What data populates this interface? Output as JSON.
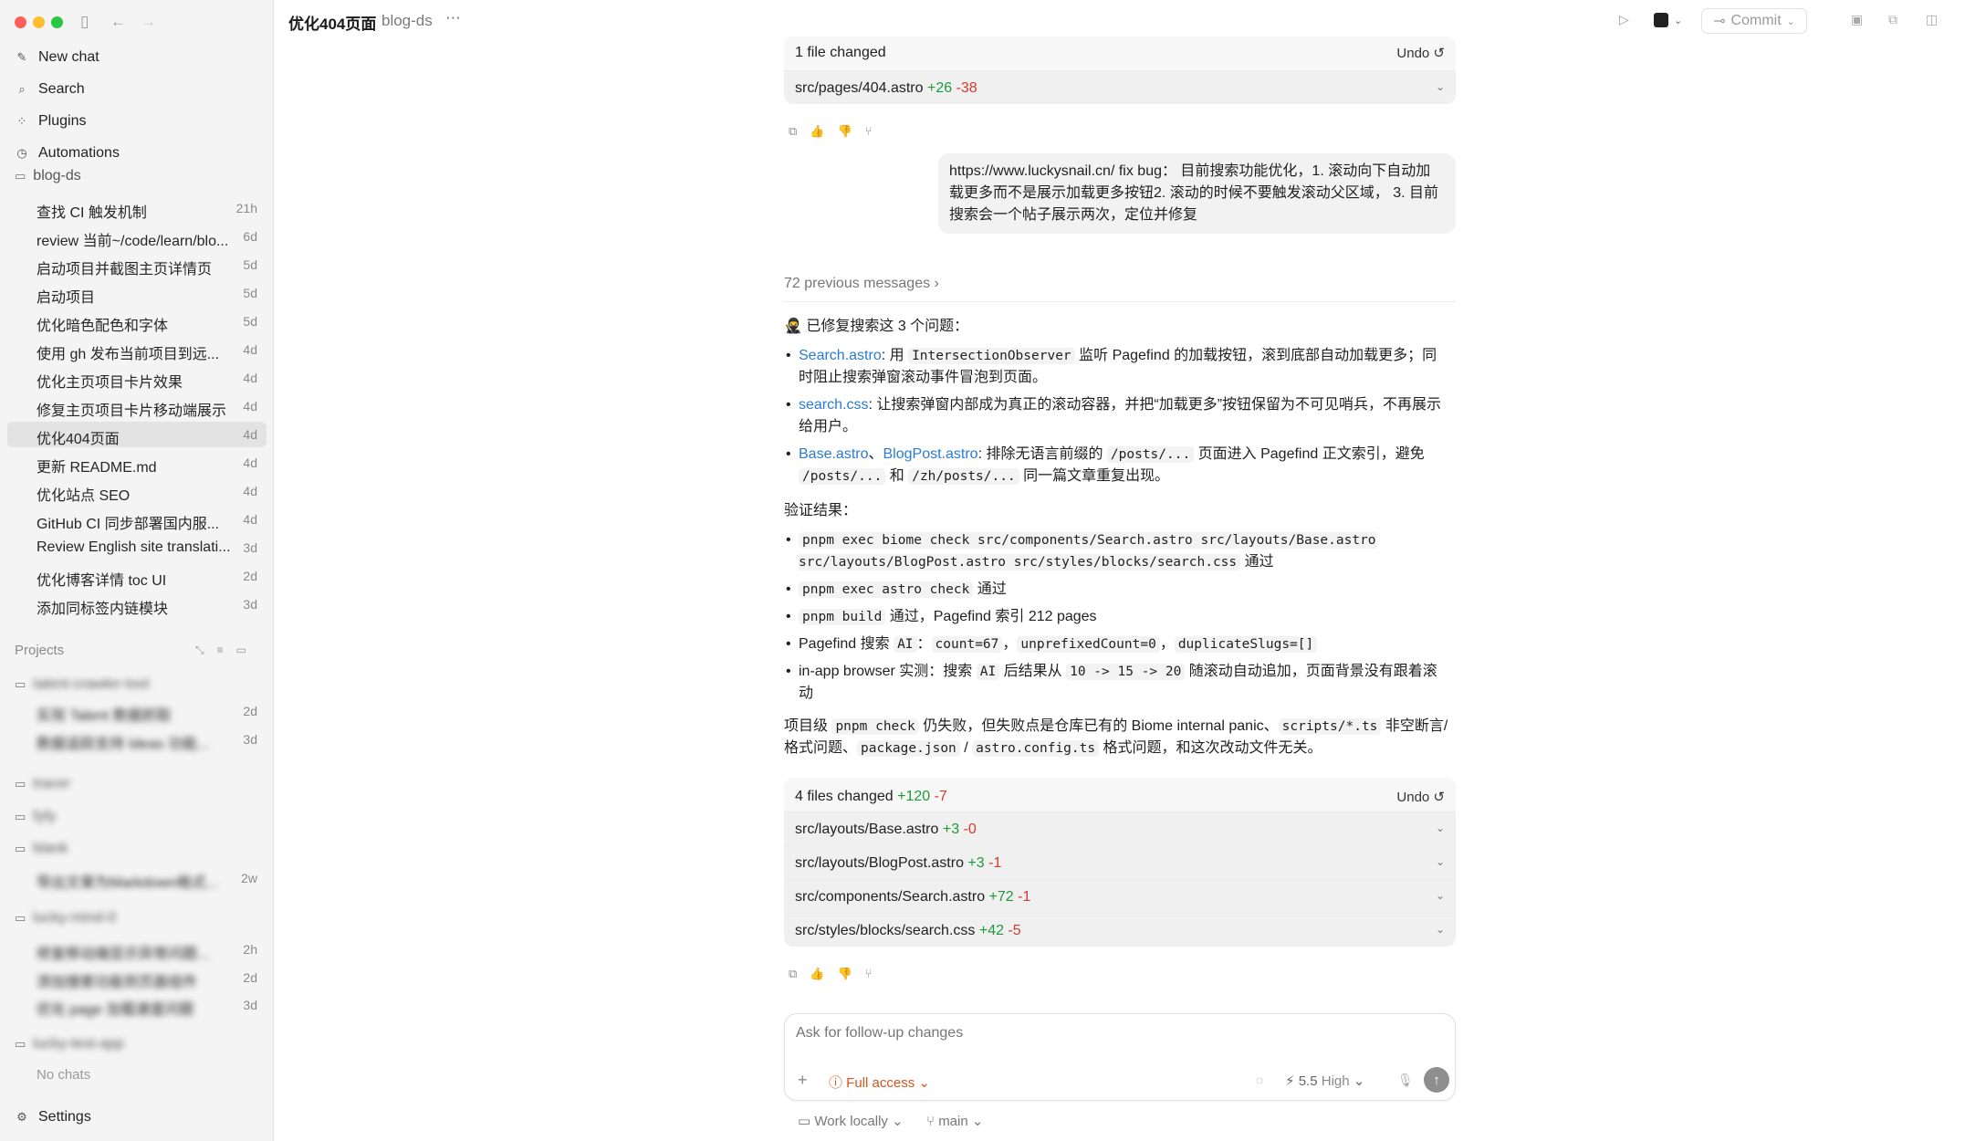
{
  "window": {
    "title": "优化404页面",
    "project": "blog-ds"
  },
  "sidebar": {
    "nav": [
      {
        "label": "New chat",
        "icon": "new-chat-icon"
      },
      {
        "label": "Search",
        "icon": "search-icon"
      },
      {
        "label": "Plugins",
        "icon": "plugins-icon"
      },
      {
        "label": "Automations",
        "icon": "clock-icon"
      }
    ],
    "workspace": "blog-ds",
    "chats": [
      {
        "title": "查找 CI 触发机制",
        "age": "21h"
      },
      {
        "title": "review 当前~/code/learn/blo...",
        "age": "6d"
      },
      {
        "title": "启动项目并截图主页详情页",
        "age": "5d"
      },
      {
        "title": "启动项目",
        "age": "5d"
      },
      {
        "title": "优化暗色配色和字体",
        "age": "5d"
      },
      {
        "title": "使用 gh 发布当前项目到远...",
        "age": "4d"
      },
      {
        "title": "优化主页项目卡片效果",
        "age": "4d"
      },
      {
        "title": "修复主页项目卡片移动端展示",
        "age": "4d"
      },
      {
        "title": "优化404页面",
        "age": "4d"
      },
      {
        "title": "更新 README.md",
        "age": "4d"
      },
      {
        "title": "优化站点 SEO",
        "age": "4d"
      },
      {
        "title": "GitHub CI 同步部署国内服...",
        "age": "4d"
      },
      {
        "title": "Review English site translati...",
        "age": "3d"
      },
      {
        "title": "优化博客详情 toc UI",
        "age": "2d"
      },
      {
        "title": "添加同标签内链模块",
        "age": "3d"
      }
    ],
    "projects_label": "Projects",
    "project_groups": [
      {
        "name": "talent-crawler-tool",
        "chats": [
          {
            "title": "实现 Talent 数据抓取",
            "age": "2d"
          },
          {
            "title": "数据追踪支持 Ideas 功能...",
            "age": "3d"
          }
        ]
      },
      {
        "name": "tracer",
        "chats": []
      },
      {
        "name": "fyfy",
        "chats": []
      },
      {
        "name": "blank",
        "chats": [
          {
            "title": "导出文章为Markdown格式...",
            "age": "2w"
          }
        ]
      },
      {
        "name": "lucky-mind-0",
        "chats": [
          {
            "title": "修复移动端显示异常问题...",
            "age": "2h"
          },
          {
            "title": "添加搜索功能到页面组件",
            "age": "2d"
          },
          {
            "title": "优化 page 加载速度问题",
            "age": "3d"
          }
        ]
      },
      {
        "name": "lucky-test-app",
        "chats": []
      }
    ],
    "no_chats": "No chats",
    "settings": "Settings"
  },
  "toolbar": {
    "commit": "Commit"
  },
  "top_card": {
    "header": "1 file changed",
    "undo": "Undo",
    "files": [
      {
        "path": "src/pages/404.astro",
        "plus": "+26",
        "minus": "-38"
      }
    ]
  },
  "user_message": "https://www.luckysnail.cn/ fix bug： 目前搜索功能优化，1. 滚动向下自动加载更多而不是展示加载更多按钮2. 滚动的时候不要触发滚动父区域， 3. 目前搜索会一个帖子展示两次，定位并修复",
  "previous_messages": "72 previous messages",
  "assistant": {
    "intro": "已修复搜索这 3 个问题：",
    "fixes": [
      {
        "file": "Search.astro",
        "pre": ": 用 ",
        "code": "IntersectionObserver",
        "post": " 监听 Pagefind 的加载按钮，滚到底部自动加载更多；同时阻止搜索弹窗滚动事件冒泡到页面。"
      },
      {
        "file": "search.css",
        "text": ": 让搜索弹窗内部成为真正的滚动容器，并把“加载更多”按钮保留为不可见哨兵，不再展示给用户。"
      },
      {
        "file": "Base.astro",
        "sep": "、",
        "file2": "BlogPost.astro",
        "pre": ": 排除无语言前缀的 ",
        "code1": "/posts/...",
        "mid1": " 页面进入 Pagefind 正文索引，避免 ",
        "code2": "/posts/...",
        "mid2": " 和 ",
        "code3": "/zh/posts/...",
        "post": " 同一篇文章重复出现。"
      }
    ],
    "verify_title": "验证结果：",
    "verify": [
      {
        "code": "pnpm exec biome check src/components/Search.astro src/layouts/Base.astro src/layouts/BlogPost.astro src/styles/blocks/search.css",
        "post": " 通过"
      },
      {
        "code": "pnpm exec astro check",
        "post": " 通过"
      },
      {
        "code": "pnpm build",
        "post": " 通过，Pagefind 索引 212 pages"
      },
      {
        "pre": "Pagefind 搜索 ",
        "code": "AI",
        "mid": "：",
        "code2": "count=67",
        "mid2": "，",
        "code3": "unprefixedCount=0",
        "mid3": "，",
        "code4": "duplicateSlugs=[]"
      },
      {
        "pre": "in-app browser 实测：搜索 ",
        "code": "AI",
        "mid": " 后结果从 ",
        "code2": "10 -> 15 -> 20",
        "post": " 随滚动自动追加，页面背景没有跟着滚动"
      }
    ],
    "closing": {
      "pre": "项目级 ",
      "code1": "pnpm check",
      "mid1": " 仍失败，但失败点是仓库已有的 Biome internal panic、",
      "code2": "scripts/*.ts",
      "mid2": " 非空断言/格式问题、",
      "code3": "package.json",
      "mid3": " / ",
      "code4": "astro.config.ts",
      "post": " 格式问题，和这次改动文件无关。"
    }
  },
  "bottom_card": {
    "header": "4 files changed",
    "plus": "+120",
    "minus": "-7",
    "undo": "Undo",
    "files": [
      {
        "path": "src/layouts/Base.astro",
        "plus": "+3",
        "minus": "-0"
      },
      {
        "path": "src/layouts/BlogPost.astro",
        "plus": "+3",
        "minus": "-1"
      },
      {
        "path": "src/components/Search.astro",
        "plus": "+72",
        "minus": "-1"
      },
      {
        "path": "src/styles/blocks/search.css",
        "plus": "+42",
        "minus": "-5"
      }
    ]
  },
  "composer": {
    "placeholder": "Ask for follow-up changes",
    "access": "Full access",
    "model": "5.5",
    "effort": "High",
    "work": "Work locally",
    "branch": "main"
  },
  "colors": {
    "plus": "#1a9c3a",
    "minus": "#d33a2f",
    "link": "#2a7bd4",
    "access": "#d9531e"
  }
}
